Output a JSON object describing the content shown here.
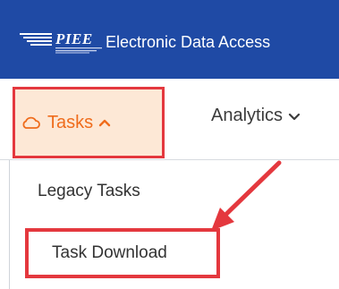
{
  "header": {
    "logo_text": "PIEE",
    "app_title": "Electronic Data Access"
  },
  "nav": {
    "tasks": {
      "label": "Tasks",
      "icon": "cloud-icon",
      "caret": "caret-up-icon",
      "expanded": true
    },
    "analytics": {
      "label": "Analytics",
      "caret": "caret-down-icon"
    }
  },
  "menu": {
    "items": [
      {
        "label": "Legacy Tasks"
      },
      {
        "label": "Task Download"
      }
    ]
  },
  "colors": {
    "header_bg": "#1f4aa5",
    "highlight_border": "#e4383e",
    "tasks_active_bg": "#fde8d6",
    "tasks_active_text": "#ef6c1c",
    "annotation_arrow": "#e4383e"
  }
}
